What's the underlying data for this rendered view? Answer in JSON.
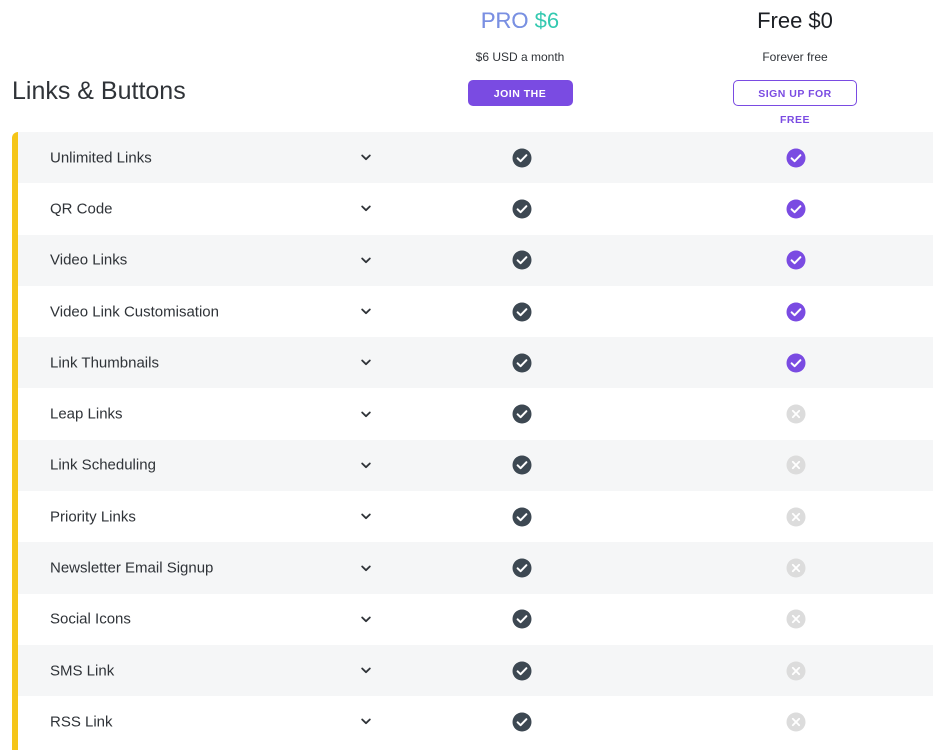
{
  "section": {
    "title": "Links & Buttons"
  },
  "plans": {
    "pro": {
      "name_word": "PRO",
      "name_price": "$6",
      "subtitle": "$6 USD a month",
      "button_label": "JOIN THE PROS"
    },
    "free": {
      "name": "Free $0",
      "subtitle": "Forever free",
      "button_label": "SIGN UP FOR FREE"
    }
  },
  "colors": {
    "accent_bar": "#f5c518",
    "brand_purple": "#7a4be2",
    "pro_check": "#3d4852",
    "free_cross": "#dcdcdc",
    "pro_price": "#33c9b0"
  },
  "icons": {
    "expand": "chevron-down-icon",
    "pro_included": "check-circle-icon",
    "free_included": "check-circle-icon",
    "free_excluded": "x-circle-icon"
  },
  "features": [
    {
      "label": "Unlimited Links",
      "pro": true,
      "free": true
    },
    {
      "label": "QR Code",
      "pro": true,
      "free": true
    },
    {
      "label": "Video Links",
      "pro": true,
      "free": true
    },
    {
      "label": "Video Link Customisation",
      "pro": true,
      "free": true
    },
    {
      "label": "Link Thumbnails",
      "pro": true,
      "free": true
    },
    {
      "label": "Leap Links",
      "pro": true,
      "free": false
    },
    {
      "label": "Link Scheduling",
      "pro": true,
      "free": false
    },
    {
      "label": "Priority Links",
      "pro": true,
      "free": false
    },
    {
      "label": "Newsletter Email Signup",
      "pro": true,
      "free": false
    },
    {
      "label": "Social Icons",
      "pro": true,
      "free": false
    },
    {
      "label": "SMS Link",
      "pro": true,
      "free": false
    },
    {
      "label": "RSS Link",
      "pro": true,
      "free": false
    }
  ]
}
